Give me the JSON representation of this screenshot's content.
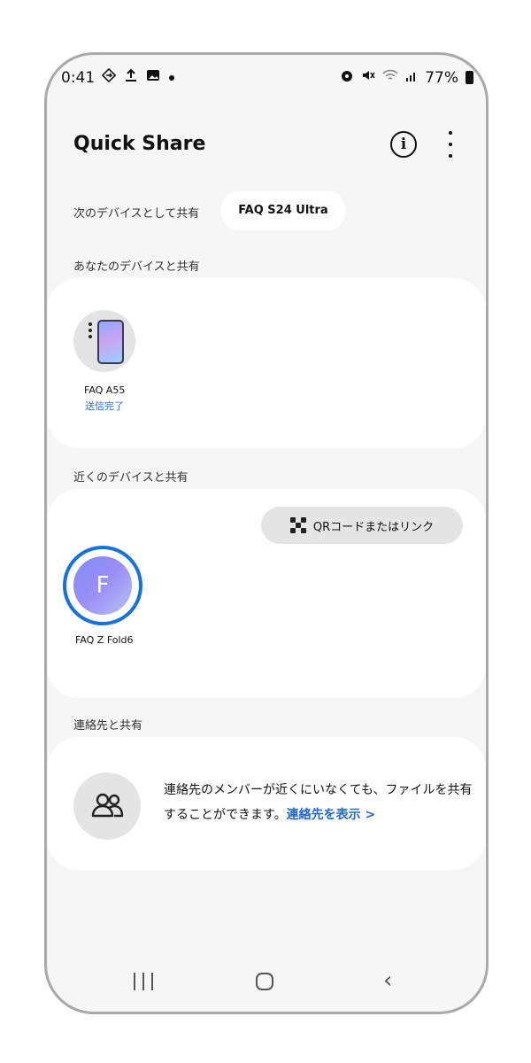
{
  "status_bar": {
    "time": "0:41",
    "left_icons": [
      "sync-icon",
      "upload-icon",
      "image-icon",
      "notification-dot"
    ],
    "right_icons": [
      "alarm-icon",
      "mute-icon",
      "wifi-icon",
      "signal-icon",
      "battery-icon"
    ],
    "battery": "77%"
  },
  "header": {
    "title": "Quick Share"
  },
  "share_as": {
    "label": "次のデバイスとして共有",
    "device": "FAQ S24 Ultra"
  },
  "your_devices": {
    "label": "あなたのデバイスと共有",
    "devices": [
      {
        "name": "FAQ A55",
        "status": "送信完了"
      }
    ]
  },
  "nearby": {
    "label": "近くのデバイスと共有",
    "qr_button": "QRコードまたはリンク",
    "devices": [
      {
        "initial": "F",
        "name": "FAQ Z Fold6"
      }
    ]
  },
  "contacts": {
    "label": "連絡先と共有",
    "text": "連絡先のメンバーが近くにいなくても、ファイルを共有することができます。",
    "link": "連絡先を表示 >"
  },
  "colors": {
    "accent": "#1570e0",
    "link": "#2066d4",
    "background": "#f6f6f6"
  }
}
